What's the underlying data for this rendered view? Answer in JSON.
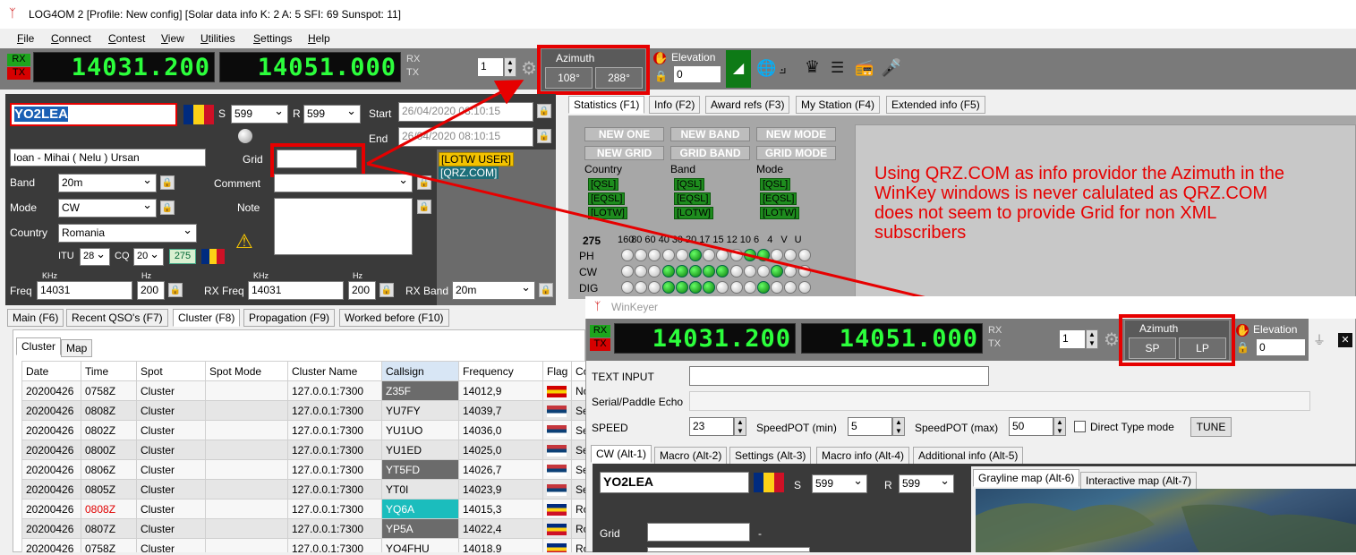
{
  "window": {
    "title": "LOG4OM 2 [Profile: New config] [Solar data info K: 2 A: 5 SFI: 69 Sunspot: 11]"
  },
  "menu": [
    "File",
    "Connect",
    "Contest",
    "View",
    "Utilities",
    "Settings",
    "Help"
  ],
  "radio": {
    "rx_label": "RX",
    "tx_label": "TX",
    "freq1": "14031.200",
    "freq2": "14051.000",
    "rx2": "RX",
    "tx2": "TX",
    "vfo": "1",
    "azimuth_title": "Azimuth",
    "az_sp": "108°",
    "az_lp": "288°",
    "elevation_title": "Elevation",
    "elevation_value": "0"
  },
  "qso": {
    "callsign": "YO2LEA",
    "s_label": "S",
    "s_value": "599",
    "r_label": "R",
    "r_value": "599",
    "start_label": "Start",
    "start_value": "26/04/2020 08:10:15",
    "end_label": "End",
    "end_value": "26/04/2020 08:10:15",
    "name": "Ioan - Mihai ( Nelu ) Ursan",
    "grid_label": "Grid",
    "grid_value": "",
    "comment_label": "Comment",
    "note_label": "Note",
    "band_label": "Band",
    "band_value": "20m",
    "mode_label": "Mode",
    "mode_value": "CW",
    "country_label": "Country",
    "country_value": "Romania",
    "itu_label": "ITU",
    "itu_value": "28",
    "cq_label": "CQ",
    "cq_value": "20",
    "dxcc": "275",
    "lotw_tag": "[LOTW USER]",
    "qrz_tag": "[QRZ.COM]",
    "khz1": "KHz",
    "hz1": "Hz",
    "khz2": "KHz",
    "hz2": "Hz",
    "freq_label": "Freq",
    "freq_value": "14031",
    "freq_hz": "200",
    "rxfreq_label": "RX Freq",
    "rxfreq_value": "14031",
    "rxfreq_hz": "200",
    "rxband_label": "RX Band",
    "rxband_value": "20m"
  },
  "info_tabs": [
    "Statistics (F1)",
    "Info (F2)",
    "Award refs (F3)",
    "My Station (F4)",
    "Extended info (F5)"
  ],
  "stats": {
    "buttons": [
      "NEW ONE",
      "NEW BAND",
      "NEW MODE",
      "NEW GRID",
      "GRID BAND",
      "GRID MODE"
    ],
    "col_country": "Country",
    "col_band": "Band",
    "col_mode": "Mode",
    "tags": [
      "[QSL]",
      "[EQSL]",
      "[LOTW]"
    ],
    "count": "275",
    "bands": [
      "160",
      "80",
      "60",
      "40",
      "30",
      "20",
      "17",
      "15",
      "12",
      "10",
      "6",
      "4",
      "V",
      "U"
    ],
    "rows": [
      {
        "label": "PH",
        "on": [
          0,
          0,
          0,
          0,
          0,
          1,
          0,
          0,
          0,
          1,
          1,
          0,
          0,
          0
        ]
      },
      {
        "label": "CW",
        "on": [
          0,
          0,
          0,
          1,
          1,
          1,
          1,
          1,
          0,
          0,
          0,
          1,
          0,
          0
        ]
      },
      {
        "label": "DIG",
        "on": [
          0,
          0,
          0,
          1,
          1,
          1,
          1,
          0,
          0,
          0,
          1,
          0,
          0,
          0
        ]
      }
    ]
  },
  "annotation": "Using QRZ.COM as info providor the Azimuth in the WinKey windows is never calulated as QRZ.COM does not seem to provide Grid for non XML subscribers",
  "bottom_tabs": [
    "Main (F6)",
    "Recent QSO's (F7)",
    "Cluster (F8)",
    "Propagation (F9)",
    "Worked before (F10)"
  ],
  "cluster_tabs": [
    "Cluster",
    "Map"
  ],
  "cluster": {
    "columns": [
      "Date",
      "Time",
      "Spot",
      "Spot Mode",
      "Cluster Name",
      "Callsign",
      "Frequency",
      "Flag",
      "Cou"
    ],
    "rows": [
      {
        "date": "20200426",
        "time": "0758Z",
        "spot": "Cluster",
        "mode": "",
        "cluster": "127.0.0.1:7300",
        "call": "Z35F",
        "freq": "14012,9",
        "country": "Nort"
      },
      {
        "date": "20200426",
        "time": "0808Z",
        "spot": "Cluster",
        "mode": "",
        "cluster": "127.0.0.1:7300",
        "call": "YU7FY",
        "freq": "14039,7",
        "country": "Serb"
      },
      {
        "date": "20200426",
        "time": "0802Z",
        "spot": "Cluster",
        "mode": "",
        "cluster": "127.0.0.1:7300",
        "call": "YU1UO",
        "freq": "14036,0",
        "country": "Serb"
      },
      {
        "date": "20200426",
        "time": "0800Z",
        "spot": "Cluster",
        "mode": "",
        "cluster": "127.0.0.1:7300",
        "call": "YU1ED",
        "freq": "14025,0",
        "country": "Serb"
      },
      {
        "date": "20200426",
        "time": "0806Z",
        "spot": "Cluster",
        "mode": "",
        "cluster": "127.0.0.1:7300",
        "call": "YT5FD",
        "freq": "14026,7",
        "country": "Serb"
      },
      {
        "date": "20200426",
        "time": "0805Z",
        "spot": "Cluster",
        "mode": "",
        "cluster": "127.0.0.1:7300",
        "call": "YT0I",
        "freq": "14023,9",
        "country": "Serb"
      },
      {
        "date": "20200426",
        "time": "0808Z",
        "spot": "Cluster",
        "mode": "",
        "cluster": "127.0.0.1:7300",
        "call": "YQ6A",
        "freq": "14015,3",
        "country": "Rom"
      },
      {
        "date": "20200426",
        "time": "0807Z",
        "spot": "Cluster",
        "mode": "",
        "cluster": "127.0.0.1:7300",
        "call": "YP5A",
        "freq": "14022,4",
        "country": "Rom"
      },
      {
        "date": "20200426",
        "time": "0758Z",
        "spot": "Cluster",
        "mode": "",
        "cluster": "127.0.0.1:7300",
        "call": "YO4FHU",
        "freq": "14018,9",
        "country": "Rom"
      }
    ]
  },
  "winkeyer": {
    "title": "WinKeyer",
    "rx": "RX",
    "tx": "TX",
    "freq1": "14031.200",
    "freq2": "14051.000",
    "rx2": "RX",
    "tx2": "TX",
    "vfo": "1",
    "azimuth_title": "Azimuth",
    "sp": "SP",
    "lp": "LP",
    "elevation_title": "Elevation",
    "elevation_value": "0",
    "text_input_label": "TEXT INPUT",
    "echo_label": "Serial/Paddle Echo",
    "speed_label": "SPEED",
    "speed_value": "23",
    "speedpot_min_label": "SpeedPOT (min)",
    "speedpot_min_value": "5",
    "speedpot_max_label": "SpeedPOT (max)",
    "speedpot_max_value": "50",
    "direct_type_label": "Direct Type mode",
    "tune_label": "TUNE",
    "tabs": [
      "CW (Alt-1)",
      "Macro (Alt-2)",
      "Settings (Alt-3)",
      "Macro info (Alt-4)",
      "Additional info (Alt-5)"
    ],
    "callsign": "YO2LEA",
    "s_label": "S",
    "s_value": "599",
    "r_label": "R",
    "r_value": "599",
    "grid_label": "Grid",
    "grid_value": "",
    "grid_suffix": "-",
    "map_tabs": [
      "Grayline map (Alt-6)",
      "Interactive map (Alt-7)"
    ]
  }
}
